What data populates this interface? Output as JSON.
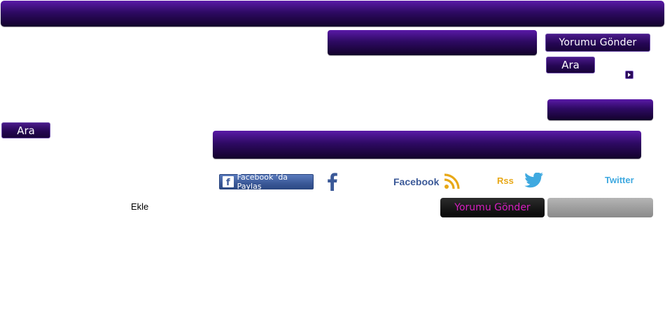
{
  "header": {
    "bar_color": "#2e0a63"
  },
  "buttons": {
    "yorumu_gonder_top": "Yorumu Gönder",
    "ara_right": "Ara",
    "ara_left": "Ara",
    "yorumu_gonder_bottom": "Yorumu Gönder"
  },
  "share": {
    "facebook_share_label": "Facebook ‘da Paylaş",
    "facebook_label": "Facebook",
    "rss_label": "Rss",
    "twitter_label": "Twitter"
  },
  "form": {
    "ekle_label": "Ekle"
  },
  "colors": {
    "brand_purple": "#2e0a63",
    "accent_magenta": "#d51fbf",
    "facebook_blue": "#3b5998",
    "rss_orange": "#e8a817",
    "twitter_blue": "#3fa9e0"
  },
  "icons": {
    "facebook": "facebook-f-icon",
    "rss": "rss-icon",
    "twitter": "twitter-bird-icon",
    "arrow": "arrow-right-icon"
  }
}
